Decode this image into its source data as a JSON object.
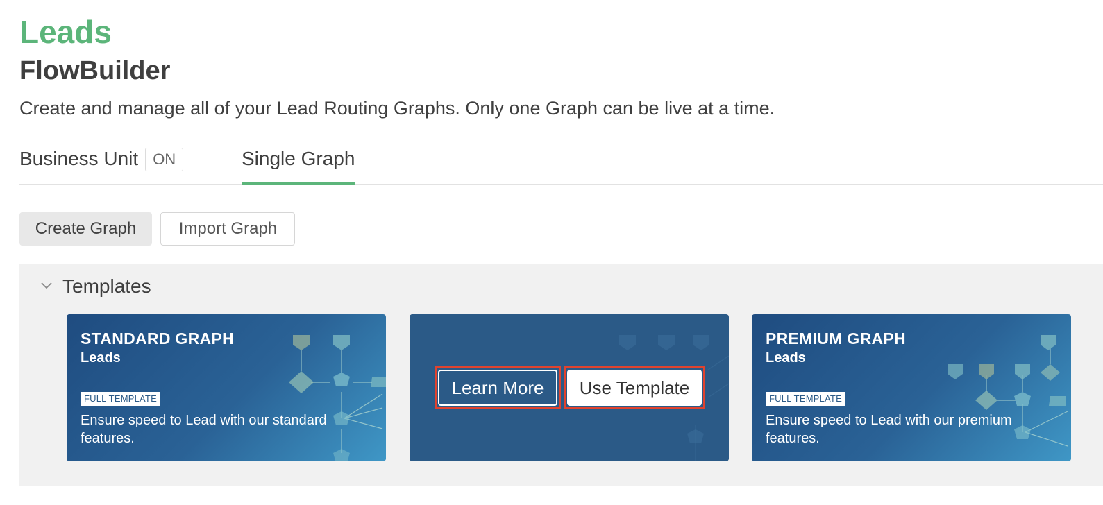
{
  "header": {
    "object_title": "Leads",
    "page_title": "FlowBuilder",
    "description": "Create and manage all of your Lead Routing Graphs. Only one Graph can be live at a time."
  },
  "tabs": [
    {
      "label": "Business Unit",
      "badge": "ON",
      "active": false
    },
    {
      "label": "Single Graph",
      "active": true
    }
  ],
  "toolbar": {
    "create_label": "Create Graph",
    "import_label": "Import Graph"
  },
  "templates": {
    "title": "Templates",
    "cards": [
      {
        "title": "STANDARD GRAPH",
        "subtitle": "Leads",
        "badge": "FULL TEMPLATE",
        "description": "Ensure speed to Lead with our standard features."
      },
      {
        "learn_more_label": "Learn More",
        "use_template_label": "Use Template"
      },
      {
        "title": "PREMIUM GRAPH",
        "subtitle": "Leads",
        "badge": "FULL TEMPLATE",
        "description": "Ensure speed to Lead with our premium features."
      }
    ]
  },
  "colors": {
    "accent_green": "#5cb57a",
    "card_blue": "#2b5a87",
    "highlight_red": "#e0432f"
  }
}
